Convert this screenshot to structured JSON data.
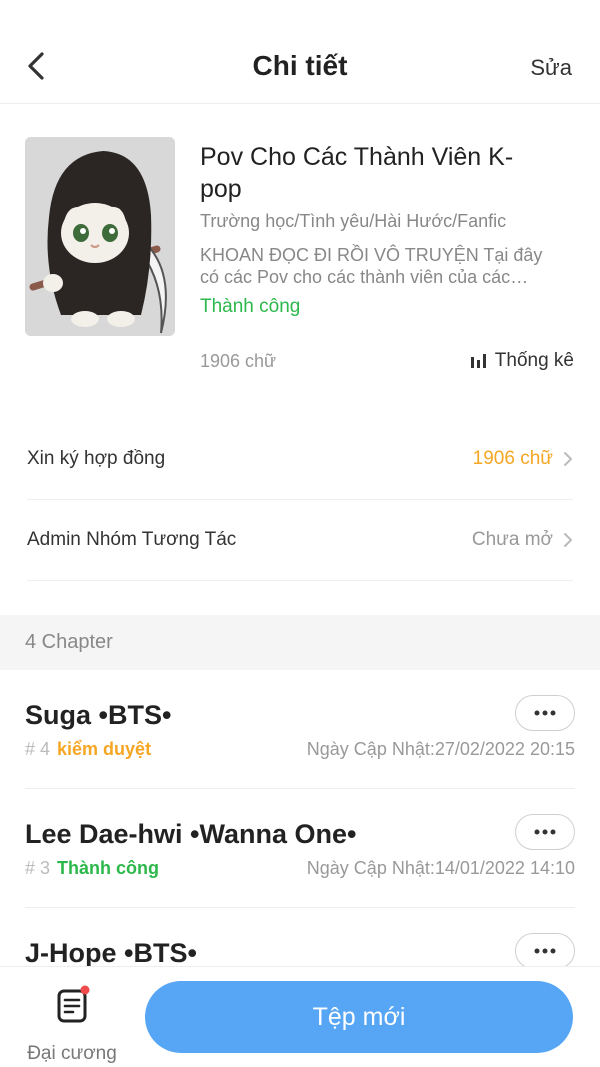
{
  "header": {
    "title": "Chi tiết",
    "edit_label": "Sửa"
  },
  "book": {
    "title": "Pov Cho Các Thành Viên K-pop",
    "tags": "Trường học/Tình yêu/Hài Hước/Fanfic",
    "description": "KHOAN ĐỌC ĐI RỒI VÔ TRUYỆN Tại đây có các Pov cho các thành viên của các nhóm nhạc K-pop",
    "status": "Thành công",
    "word_count": "1906 chữ",
    "stats_label": "Thống kê"
  },
  "rows": [
    {
      "label": "Xin ký hợp đồng",
      "value": "1906 chữ"
    },
    {
      "label": "Admin Nhóm Tương Tác",
      "value": "Chưa mở"
    }
  ],
  "chapters_section": {
    "label": "4 Chapter"
  },
  "chapters": [
    {
      "title": "Suga •BTS•",
      "number": "# 4",
      "status": "kiểm duyệt",
      "date_label": "Ngày Cập Nhật:",
      "date": "27/02/2022 20:15"
    },
    {
      "title": "Lee Dae-hwi •Wanna One•",
      "number": "# 3",
      "status": "Thành công",
      "date_label": "Ngày Cập Nhật:",
      "date": "14/01/2022 14:10"
    },
    {
      "title": "J-Hope •BTS•"
    }
  ],
  "bottom_bar": {
    "outline_label": "Đại cương",
    "new_file_label": "Tệp mới"
  },
  "colors": {
    "accent_blue": "#56a6f5",
    "success_green": "#2db84b",
    "warning_orange": "#f5a623",
    "notification_red": "#f04a4a"
  }
}
